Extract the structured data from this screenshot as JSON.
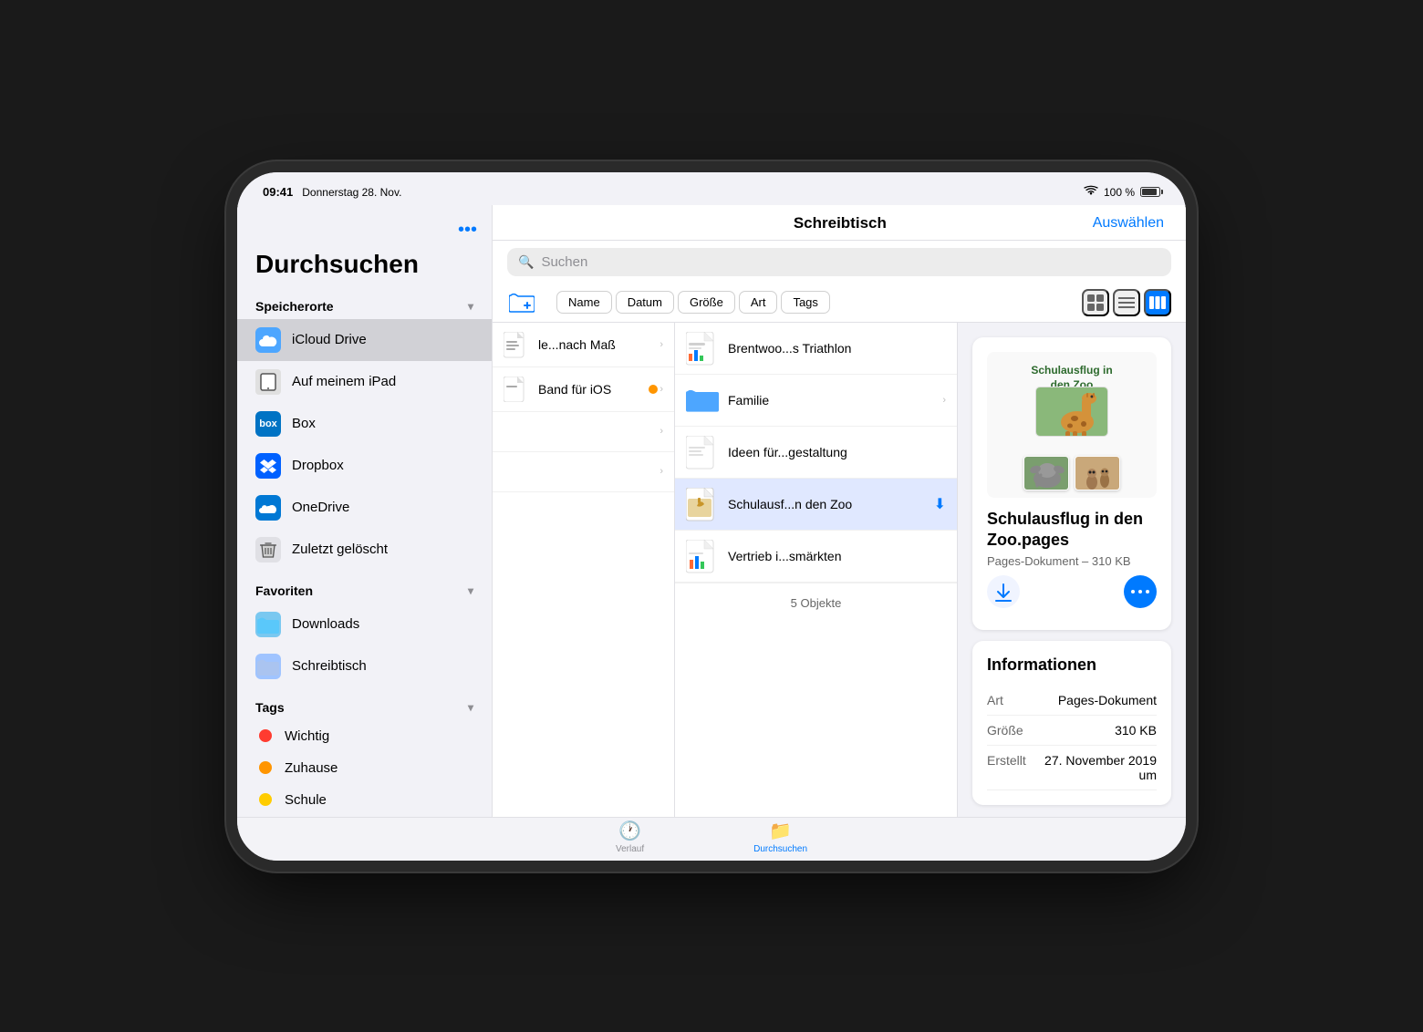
{
  "status_bar": {
    "time": "09:41",
    "date": "Donnerstag 28. Nov.",
    "wifi": "wifi",
    "battery_percent": "100 %"
  },
  "sidebar": {
    "title": "Durchsuchen",
    "more_button": "•••",
    "sections": {
      "speicherorte": {
        "label": "Speicherorte",
        "items": [
          {
            "id": "icloud",
            "label": "iCloud Drive",
            "active": true
          },
          {
            "id": "ipad",
            "label": "Auf meinem iPad"
          },
          {
            "id": "box",
            "label": "Box"
          },
          {
            "id": "dropbox",
            "label": "Dropbox"
          },
          {
            "id": "onedrive",
            "label": "OneDrive"
          },
          {
            "id": "trash",
            "label": "Zuletzt gelöscht"
          }
        ]
      },
      "favoriten": {
        "label": "Favoriten",
        "items": [
          {
            "id": "downloads",
            "label": "Downloads"
          },
          {
            "id": "desktop",
            "label": "Schreibtisch"
          }
        ]
      },
      "tags": {
        "label": "Tags",
        "items": [
          {
            "id": "wichtig",
            "label": "Wichtig",
            "color": "#ff3b30"
          },
          {
            "id": "zuhause",
            "label": "Zuhause",
            "color": "#ff9500"
          },
          {
            "id": "schule",
            "label": "Schule",
            "color": "#ffcc00"
          }
        ]
      }
    }
  },
  "main": {
    "title": "Schreibtisch",
    "select_button": "Auswählen",
    "search_placeholder": "Suchen",
    "sort_buttons": [
      "Name",
      "Datum",
      "Größe",
      "Art",
      "Tags"
    ],
    "object_count": "5 Objekte"
  },
  "columns": {
    "col1_items": [
      {
        "label": "le...nach Maß",
        "has_chevron": true,
        "type": "file"
      },
      {
        "label": "Band für iOS",
        "has_chevron": true,
        "type": "file",
        "has_orange_dot": true
      },
      {
        "label": "",
        "has_chevron": true,
        "type": "blank"
      },
      {
        "label": "",
        "has_chevron": true,
        "type": "blank"
      }
    ],
    "files": [
      {
        "label": "Brentwoo...s Triathlon",
        "type": "pages_chart",
        "has_chevron": false
      },
      {
        "label": "Familie",
        "type": "folder_blue",
        "has_chevron": true
      },
      {
        "label": "Ideen für...gestaltung",
        "type": "doc",
        "has_chevron": false
      },
      {
        "label": "Schulausf...n den Zoo",
        "type": "pages_photo",
        "selected": true,
        "has_download": true
      },
      {
        "label": "Vertrieb i...smärkten",
        "type": "pages_chart2",
        "has_chevron": false
      }
    ]
  },
  "preview": {
    "doc_title_line1": "Schulausflug in",
    "doc_title_line2": "den Zoo",
    "file_name": "Schulausflug in den Zoo.pages",
    "file_type_label": "Pages-Dokument – 310 KB",
    "info": {
      "title": "Informationen",
      "rows": [
        {
          "label": "Art",
          "value": "Pages-Dokument"
        },
        {
          "label": "Größe",
          "value": "310 KB"
        },
        {
          "label": "Erstellt",
          "value": "27. November 2019 um"
        }
      ]
    }
  },
  "tab_bar": {
    "items": [
      {
        "id": "verlauf",
        "label": "Verlauf",
        "active": false
      },
      {
        "id": "durchsuchen",
        "label": "Durchsuchen",
        "active": true
      }
    ]
  }
}
